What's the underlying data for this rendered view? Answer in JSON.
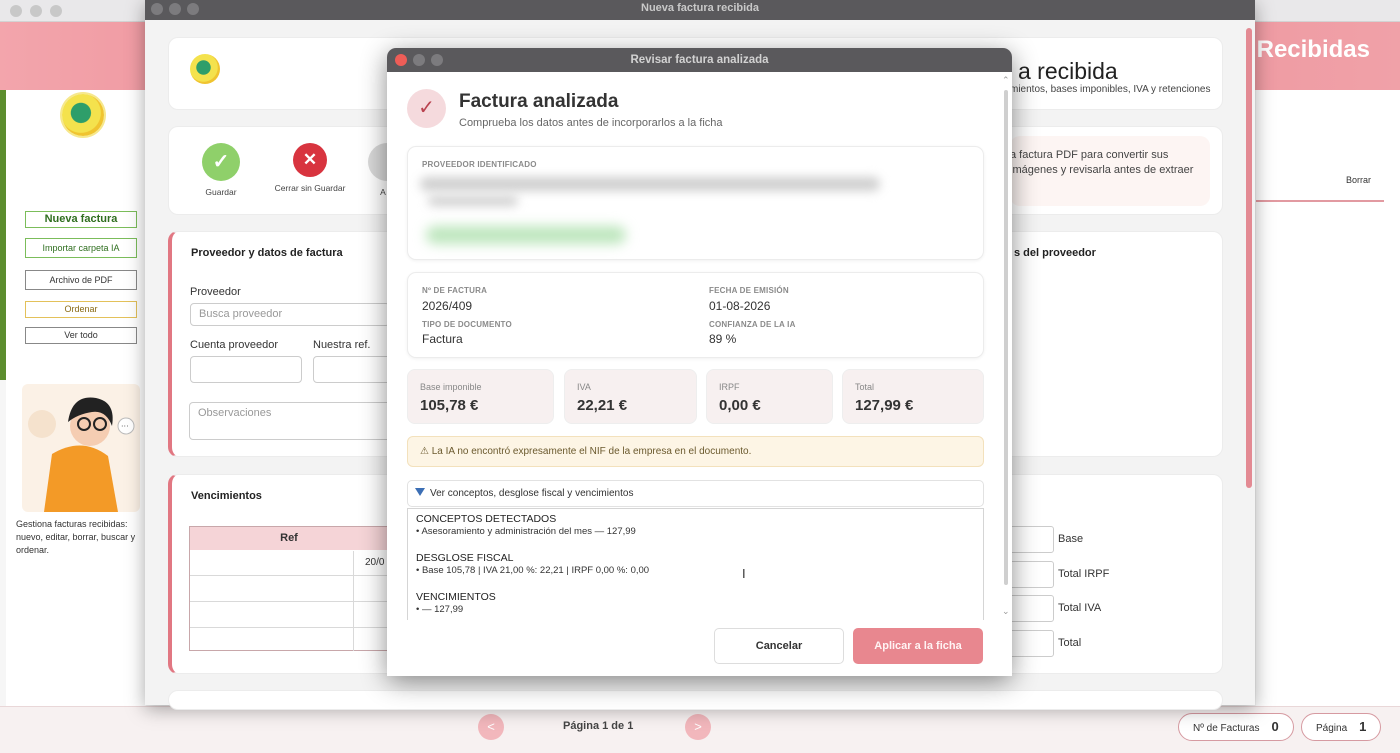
{
  "back_window": {
    "banner_title": "s Recibidas",
    "sidebar": {
      "buttons": [
        "Nueva factura",
        "Importar carpeta IA",
        "Archivo de PDF",
        "Ordenar",
        "Ver todo"
      ],
      "description": "Gestiona facturas recibidas: nuevo, editar, borrar, buscar y ordenar."
    },
    "right_panel": {
      "borrar": "Borrar"
    },
    "bottom": {
      "prev": "<",
      "next": ">",
      "page_label": "Página 1 de 1",
      "invoices_label": "Nº de Facturas",
      "invoices_count": "0",
      "page_pill_label": "Página",
      "page_pill_value": "1"
    }
  },
  "mid_window": {
    "title": "Nueva factura recibida",
    "actions": [
      {
        "label": "Guardar",
        "glyph": "✓",
        "color": "#8fd06a"
      },
      {
        "label": "Cerrar sin Guardar",
        "glyph": "✕",
        "color": "#d8343f"
      },
      {
        "label": "A",
        "glyph": "",
        "color": "#d9d9d9"
      }
    ],
    "section_provider": "Proveedor y datos de factura",
    "provider_label": "Proveedor",
    "provider_placeholder": "Busca proveedor",
    "account_label": "Cuenta proveedor",
    "ref_label": "Nuestra ref.",
    "notes_placeholder": "Observaciones",
    "section_due": "Vencimientos",
    "table_header": "Ref",
    "table_cell": "20/0",
    "right_title": "a recibida",
    "right_sub": "mientos, bases imponibles, IVA y retenciones",
    "right_info": "a factura PDF para convertir sus imágenes y revisarla antes de extraer",
    "right_section": "s del proveedor",
    "totals": [
      "Base",
      "Total IRPF",
      "Total IVA",
      "Total"
    ]
  },
  "modal": {
    "window_title": "Revisar factura analizada",
    "title": "Factura analizada",
    "subtitle": "Comprueba los datos antes de incorporarlos a la ficha",
    "provider_caption": "PROVEEDOR IDENTIFICADO",
    "fields": {
      "invoice_no_caption": "Nº DE FACTURA",
      "invoice_no": "2026/409",
      "issue_date_caption": "FECHA DE EMISIÓN",
      "issue_date": "01-08-2026",
      "doc_type_caption": "TIPO DE DOCUMENTO",
      "doc_type": "Factura",
      "confidence_caption": "CONFIANZA DE LA IA",
      "confidence": "89 %"
    },
    "totals": [
      {
        "label": "Base imponible",
        "value": "105,78 €"
      },
      {
        "label": "IVA",
        "value": "22,21 €"
      },
      {
        "label": "IRPF",
        "value": "0,00 €"
      },
      {
        "label": "Total",
        "value": "127,99 €"
      }
    ],
    "warning": "⚠  La IA no encontró expresamente el NIF de la empresa en el documento.",
    "disclosure": "Ver conceptos, desglose fiscal y vencimientos",
    "details": {
      "concepts_title": "CONCEPTOS DETECTADOS",
      "concepts_line": "• Asesoramiento y administración del mes — 127,99",
      "tax_title": "DESGLOSE FISCAL",
      "tax_line": "• Base 105,78 | IVA 21,00 %: 22,21 | IRPF 0,00 %: 0,00",
      "due_title": "VENCIMIENTOS",
      "due_line": "•  — 127,99"
    },
    "cancel": "Cancelar",
    "apply": "Aplicar a la ficha"
  }
}
